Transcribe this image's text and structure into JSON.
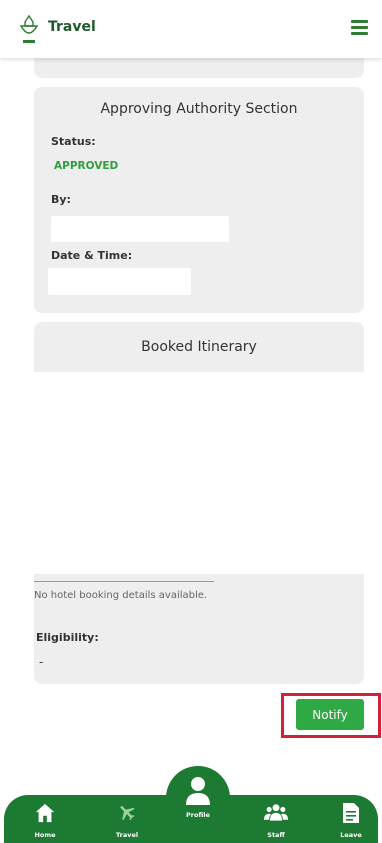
{
  "header": {
    "title": "Travel",
    "logo_icon": "logo-icon",
    "menu_icon": "hamburger-menu-icon"
  },
  "approving_authority": {
    "title": "Approving Authority Section",
    "status_label": "Status:",
    "status_value": "APPROVED",
    "by_label": "By:",
    "by_value": "",
    "datetime_label": "Date & Time:",
    "datetime_value": ""
  },
  "booked_itinerary": {
    "title": "Booked Itinerary"
  },
  "hotel": {
    "message": "No hotel booking details available."
  },
  "eligibility": {
    "label": "Eligibility:",
    "value": "-"
  },
  "notify_button": "Notify",
  "colors": {
    "brand_green": "#1d7a32",
    "status_green": "#2e9e3e",
    "button_green": "#2ea944",
    "highlight_red": "#d0203a"
  },
  "bottom_nav": {
    "home": "Home",
    "travel": "Travel",
    "profile": "Profile",
    "staff": "Staff",
    "leave": "Leave"
  }
}
